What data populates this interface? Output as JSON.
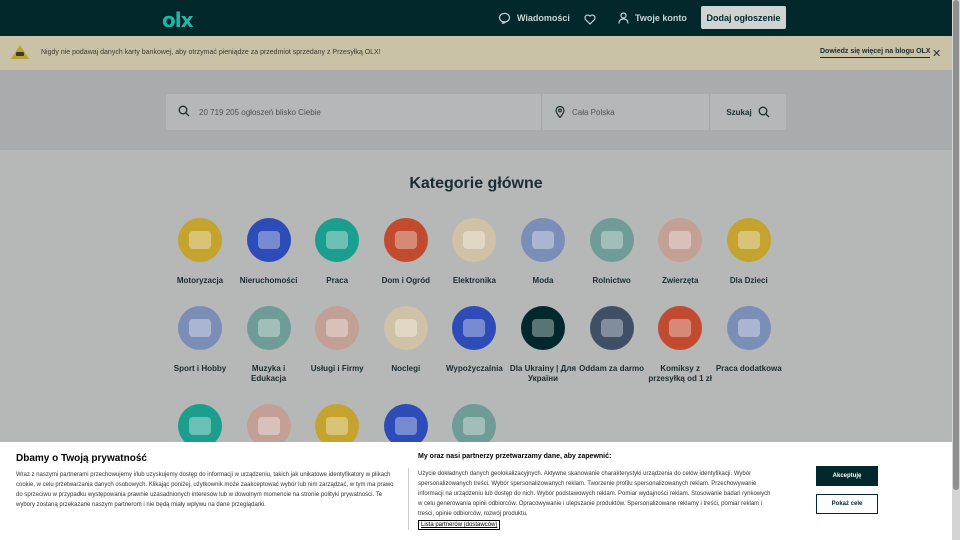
{
  "header": {
    "logo": "olx",
    "messages_label": "Wiadomości",
    "account_label": "Twoje konto",
    "add_listing_label": "Dodaj ogłoszenie"
  },
  "banner": {
    "text": "Nigdy nie podawaj danych karty bankowej, aby otrzymać pieniądze za przedmiot sprzedany z Przesyłką OLX!",
    "link": "Dowiedz się więcej na blogu OLX",
    "close": "✕"
  },
  "search": {
    "placeholder": "20 719 205 ogłoszeń blisko Ciebie",
    "location_placeholder": "Cała Polska",
    "button_label": "Szukaj"
  },
  "categories": {
    "title": "Kategorie główne",
    "items": [
      {
        "label": "Motoryzacja",
        "color": "#c4a42f"
      },
      {
        "label": "Nieruchomości",
        "color": "#2e4cb8"
      },
      {
        "label": "Praca",
        "color": "#1b9e8e"
      },
      {
        "label": "Dom i Ogród",
        "color": "#c24a2e"
      },
      {
        "label": "Elektronika",
        "color": "#cfc2a6"
      },
      {
        "label": "Moda",
        "color": "#7b8eb8"
      },
      {
        "label": "Rolnictwo",
        "color": "#6f9c96"
      },
      {
        "label": "Zwierzęta",
        "color": "#c2a095"
      },
      {
        "label": "Dla Dzieci",
        "color": "#c4a42f"
      },
      {
        "label": "Sport i Hobby",
        "color": "#7b8eb8"
      },
      {
        "label": "Muzyka i Edukacja",
        "color": "#6f9c96"
      },
      {
        "label": "Usługi i Firmy",
        "color": "#c2a095"
      },
      {
        "label": "Noclegi",
        "color": "#cfc2a6"
      },
      {
        "label": "Wypożyczalnia",
        "color": "#2e4cb8"
      },
      {
        "label": "Dla Ukrainy | Для України",
        "color": "#02282c"
      },
      {
        "label": "Oddam za darmo",
        "color": "#3f5066"
      },
      {
        "label": "Komiksy z przesyłką od 1 zł",
        "color": "#c24a2e"
      },
      {
        "label": "Praca dodatkowa",
        "color": "#7b8eb8"
      },
      {
        "label": "",
        "color": "#1b9e8e"
      },
      {
        "label": "",
        "color": "#c2a095"
      },
      {
        "label": "",
        "color": "#c4a42f"
      },
      {
        "label": "",
        "color": "#2e4cb8"
      },
      {
        "label": "",
        "color": "#6f9c96"
      }
    ]
  },
  "cookie": {
    "title": "Dbamy o Twoją prywatność",
    "body": "Wraz z naszymi partnerami przechowujemy i/lub uzyskujemy dostęp do informacji w urządzeniu, takich jak unikatowe identyfikatory w plikach cookie, w celu przetwarzania danych osobowych. Klikając poniżej, użytkownik może zaakceptować wybór lub nim zarządzać, w tym ma prawo do sprzeciwu w przypadku występowania prawnie uzasadnionych interesów lub w dowolnym momencie na stronie polityki prywatności. Te wybory zostaną przekazane naszym partnerom i nie będą miały wpływu na dane przeglądarki.",
    "right_title": "My oraz nasi partnerzy przetwarzamy dane, aby zapewnić:",
    "right_body": "Użycie dokładnych danych geolokalizacyjnych. Aktywne skanowanie charakterystyki urządzenia do celów identyfikacji. Wybór spersonalizowanych treści. Wybór spersonalizowanych reklam. Tworzenie profilu spersonalizowanych reklam. Przechowywanie informacji na urządzeniu lub dostęp do nich. Wybór podstawowych reklam. Pomiar wydajności reklam. Stosowanie badań rynkowych w celu generowania opinii odbiorców. Opracowywanie i ulepszanie produktów. Spersonalizowane reklamy i treści, pomiar reklam i treści, opinie odbiorców, rozwój produktu.",
    "partners_link": "Lista partnerów (dostawców)",
    "accept_label": "Akceptuję",
    "goals_label": "Pokaż cele"
  }
}
